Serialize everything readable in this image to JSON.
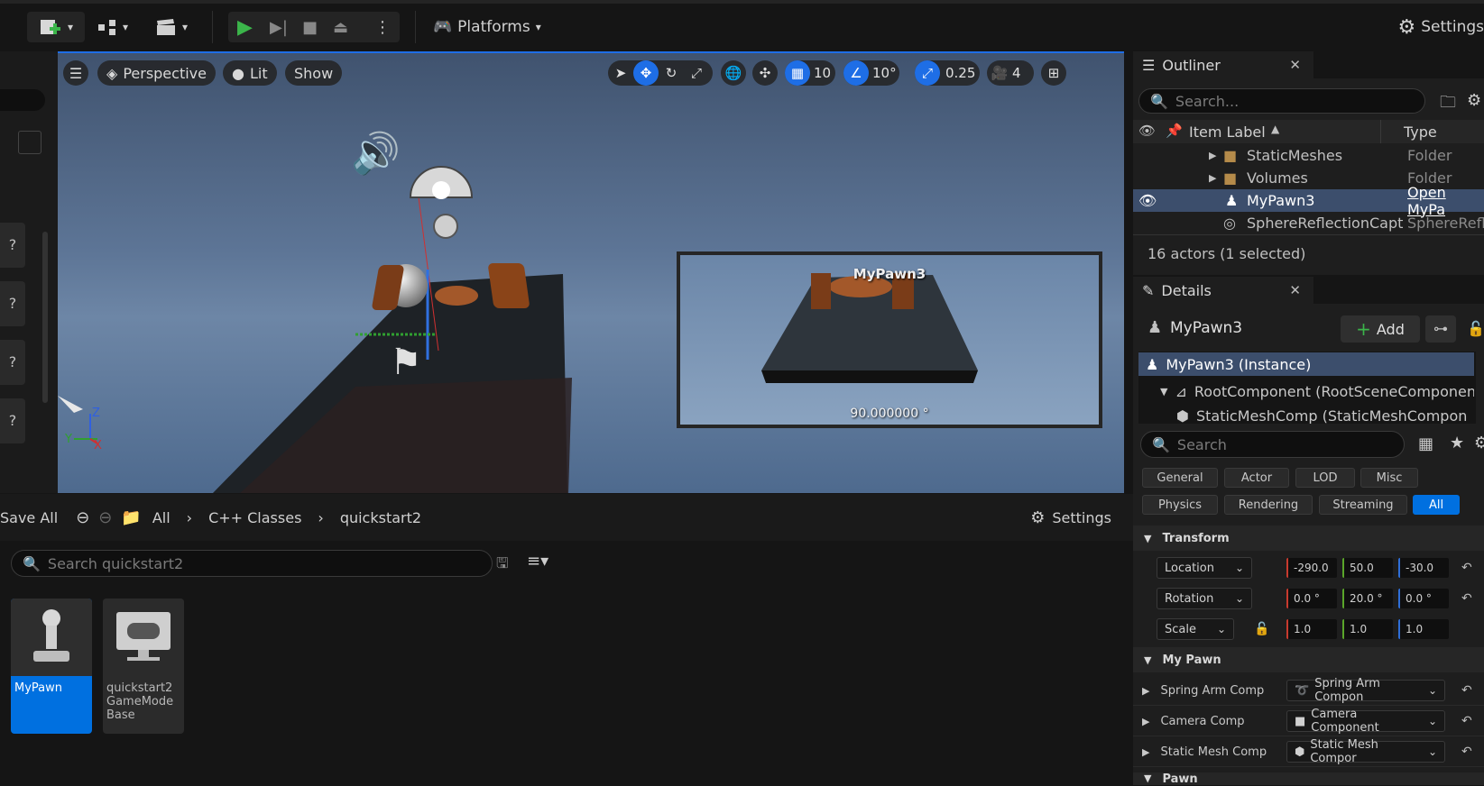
{
  "toolbar": {
    "platforms_label": "Platforms",
    "settings_label": "Settings"
  },
  "viewport": {
    "perspective_label": "Perspective",
    "lit_label": "Lit",
    "show_label": "Show",
    "grid_value": "10",
    "angle_value": "10°",
    "scale_value": "0.25",
    "camera_speed": "4",
    "pip_title": "MyPawn3",
    "pip_angle": "90.000000 °",
    "axis_z": "Z",
    "axis_y": "Y",
    "axis_x": "X"
  },
  "content_browser": {
    "save_all": "Save All",
    "breadcrumb": [
      "All",
      "C++ Classes",
      "quickstart2"
    ],
    "settings_label": "Settings",
    "search_placeholder": "Search quickstart2",
    "assets": [
      {
        "name": "MyPawn",
        "selected": true
      },
      {
        "name": "quickstart2 GameMode Base",
        "selected": false
      }
    ]
  },
  "outliner": {
    "tab_label": "Outliner",
    "search_placeholder": "Search...",
    "col_label": "Item Label",
    "col_type": "Type",
    "rows": [
      {
        "label": "StaticMeshes",
        "type": "Folder"
      },
      {
        "label": "Volumes",
        "type": "Folder"
      },
      {
        "label": "MyPawn3",
        "type": "Open MyPa"
      },
      {
        "label": "SphereReflectionCapt",
        "type": "SphereRefl"
      }
    ],
    "status": "16 actors (1 selected)"
  },
  "details": {
    "tab_label": "Details",
    "object_name": "MyPawn3",
    "add_label": "Add",
    "components": [
      "MyPawn3 (Instance)",
      "RootComponent (RootSceneComponen",
      "StaticMeshComp (StaticMeshCompon"
    ],
    "search_placeholder": "Search",
    "categories_row1": [
      "General",
      "Actor",
      "LOD",
      "Misc"
    ],
    "categories_row2": [
      "Physics",
      "Rendering",
      "Streaming",
      "All"
    ],
    "transform_header": "Transform",
    "location_label": "Location",
    "location": [
      "-290.0",
      "50.0",
      "-30.0"
    ],
    "rotation_label": "Rotation",
    "rotation": [
      "0.0 °",
      "20.0 °",
      "0.0 °"
    ],
    "scale_label": "Scale",
    "scale": [
      "1.0",
      "1.0",
      "1.0"
    ],
    "mypawn_header": "My Pawn",
    "spring_arm_label": "Spring Arm Comp",
    "spring_arm_value": "Spring Arm Compon",
    "camera_label": "Camera Comp",
    "camera_value": "Camera Component",
    "static_mesh_label": "Static Mesh Comp",
    "static_mesh_value": "Static Mesh Compor",
    "pawn_header": "Pawn"
  }
}
